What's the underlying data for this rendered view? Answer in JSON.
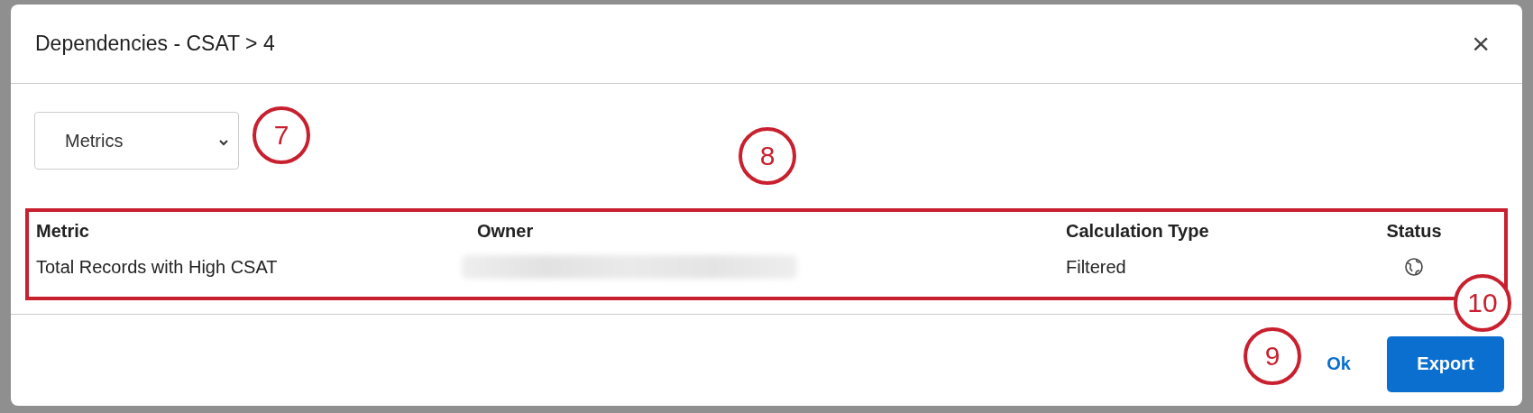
{
  "dialog": {
    "title": "Dependencies - CSAT > 4",
    "close_icon": "×"
  },
  "type_select": {
    "value": "Metrics"
  },
  "table": {
    "columns": [
      {
        "label": "Metric"
      },
      {
        "label": "Owner"
      },
      {
        "label": "Calculation Type"
      },
      {
        "label": "Status"
      }
    ],
    "rows": [
      {
        "metric": "Total Records with High CSAT",
        "owner": {
          "kind": "redacted"
        },
        "calculation_type": "Filtered",
        "status": {
          "kind": "globe"
        }
      }
    ]
  },
  "buttons": [
    {
      "label": "Ok",
      "kind": "link"
    },
    {
      "label": "Export",
      "kind": "primary"
    }
  ],
  "callouts": [
    {
      "label": "7"
    },
    {
      "label": "8"
    },
    {
      "label": "9"
    },
    {
      "label": "10"
    }
  ]
}
